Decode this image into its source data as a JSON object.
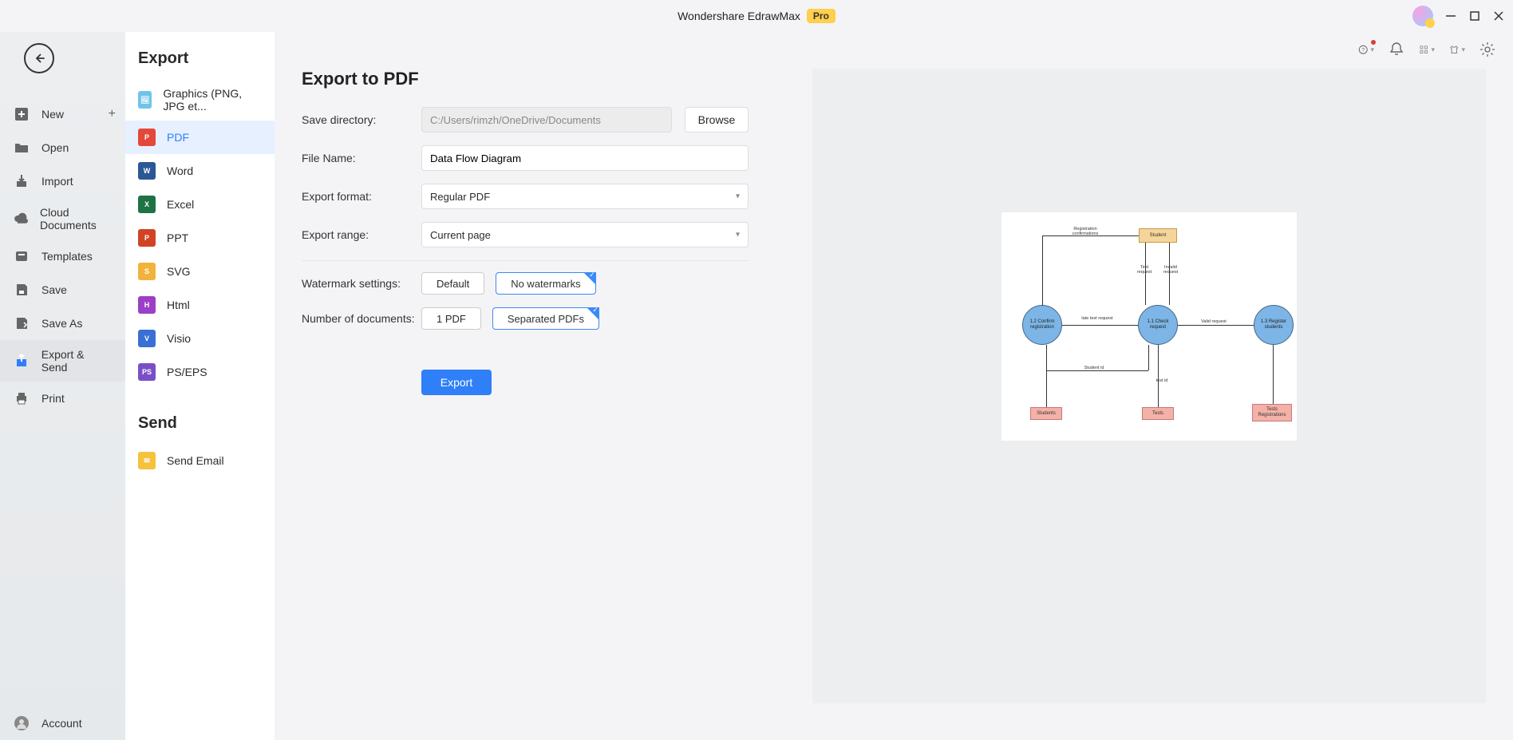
{
  "app": {
    "title": "Wondershare EdrawMax",
    "badge": "Pro"
  },
  "sidebar": {
    "items": [
      {
        "label": "New"
      },
      {
        "label": "Open"
      },
      {
        "label": "Import"
      },
      {
        "label": "Cloud Documents"
      },
      {
        "label": "Templates"
      },
      {
        "label": "Save"
      },
      {
        "label": "Save As"
      },
      {
        "label": "Export & Send"
      },
      {
        "label": "Print"
      }
    ],
    "account": "Account"
  },
  "export_panel": {
    "heading": "Export",
    "items": [
      {
        "label": "Graphics (PNG, JPG et..."
      },
      {
        "label": "PDF"
      },
      {
        "label": "Word"
      },
      {
        "label": "Excel"
      },
      {
        "label": "PPT"
      },
      {
        "label": "SVG"
      },
      {
        "label": "Html"
      },
      {
        "label": "Visio"
      },
      {
        "label": "PS/EPS"
      }
    ],
    "send_heading": "Send",
    "send_item": "Send Email"
  },
  "form": {
    "title": "Export to PDF",
    "save_dir_label": "Save directory:",
    "save_dir_value": "C:/Users/rimzh/OneDrive/Documents",
    "browse": "Browse",
    "filename_label": "File Name:",
    "filename_value": "Data Flow Diagram",
    "format_label": "Export format:",
    "format_value": "Regular PDF",
    "range_label": "Export range:",
    "range_value": "Current page",
    "watermark_label": "Watermark settings:",
    "watermark_default": "Default",
    "watermark_none": "No watermarks",
    "numdocs_label": "Number of documents:",
    "numdocs_one": "1 PDF",
    "numdocs_sep": "Separated PDFs",
    "export_action": "Export"
  },
  "preview": {
    "student": "Student",
    "check": "1.1 Check request",
    "confirm": "1.2 Confirm registration",
    "register": "1.3 Register students",
    "students_store": "Students",
    "tests_store": "Tests",
    "tests_reg_store": "Tests Registrations",
    "l_reg_conf": "Registration confirmations",
    "l_test_req": "Test request",
    "l_invalid": "Invalid request",
    "l_latetest": "late test request",
    "l_valid": "Valid request",
    "l_student_id": "Student id",
    "l_test_id": "test id"
  }
}
